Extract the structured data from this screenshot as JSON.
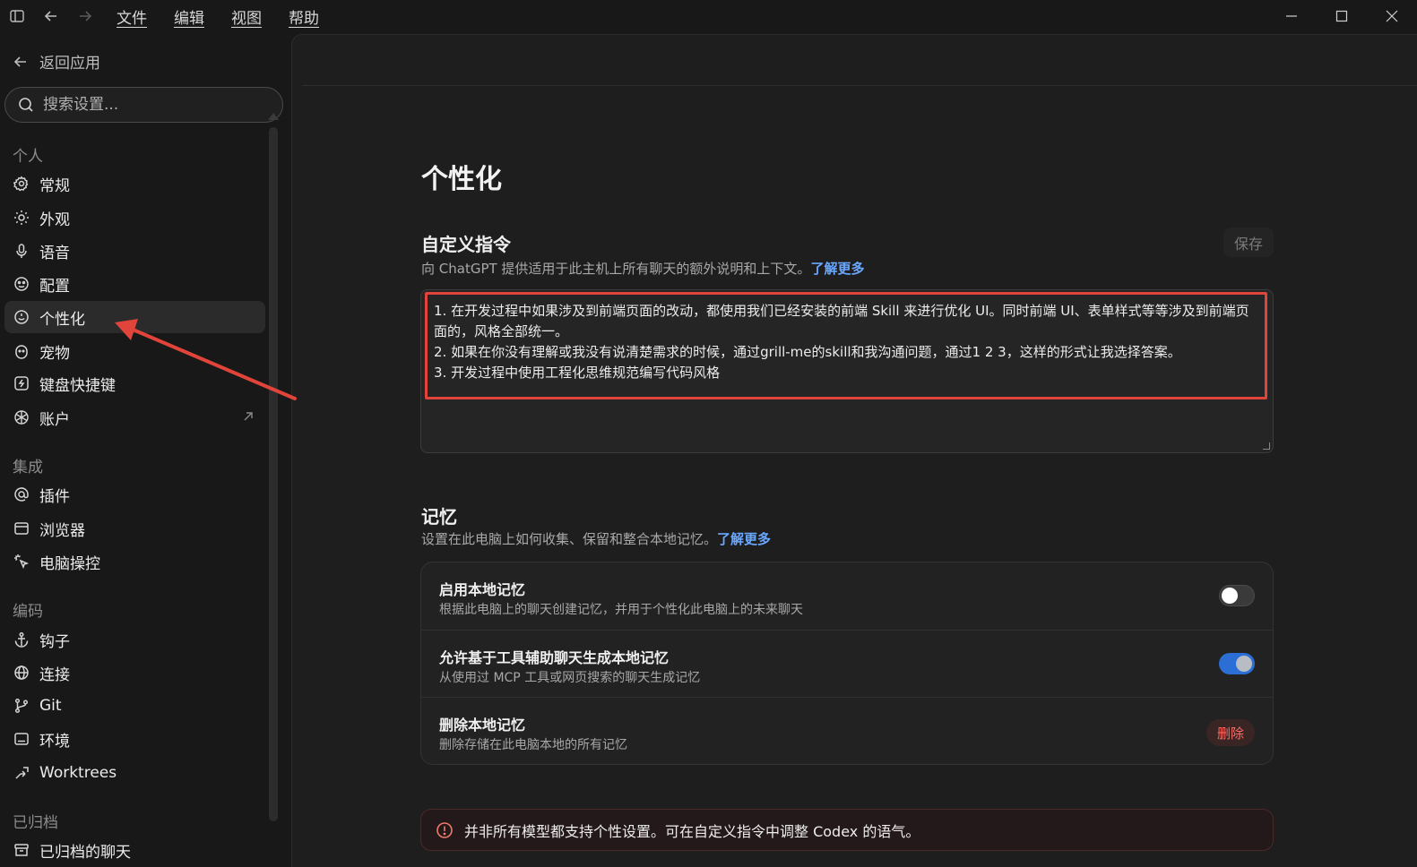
{
  "menu": [
    "文件",
    "编辑",
    "视图",
    "帮助"
  ],
  "sidebar": {
    "back_label": "返回应用",
    "search_placeholder": "搜索设置...",
    "groups": {
      "personal": "个人",
      "integrations": "集成",
      "coding": "编码",
      "archived": "已归档"
    },
    "items": {
      "general": "常规",
      "appearance": "外观",
      "voice": "语音",
      "config": "配置",
      "personalization": "个性化",
      "pets": "宠物",
      "shortcuts": "键盘快捷键",
      "account": "账户",
      "plugins": "插件",
      "browser": "浏览器",
      "computer_use": "电脑操控",
      "hooks": "钩子",
      "connections": "连接",
      "git": "Git",
      "environments": "环境",
      "worktrees": "Worktrees",
      "archived_chats": "已归档的聊天"
    }
  },
  "main": {
    "title": "个性化",
    "custom": {
      "title": "自定义指令",
      "desc": "向 ChatGPT 提供适用于此主机上所有聊天的额外说明和上下文。",
      "link": "了解更多",
      "save": "保存",
      "lines": [
        "1. 在开发过程中如果涉及到前端页面的改动，都使用我们已经安装的前端 Skill 来进行优化 UI。同时前端 UI、表单样式等等涉及到前端页面的，风格全部统一。",
        "2. 如果在你没有理解或我没有说清楚需求的时候，通过grill-me的skill和我沟通问题，通过1 2 3，这样的形式让我选择答案。",
        "3. 开发过程中使用工程化思维规范编写代码风格"
      ]
    },
    "memory": {
      "title": "记忆",
      "desc": "设置在此电脑上如何收集、保留和整合本地记忆。",
      "link": "了解更多",
      "rows": [
        {
          "title": "启用本地记忆",
          "desc": "根据此电脑上的聊天创建记忆，并用于个性化此电脑上的未来聊天",
          "state": false
        },
        {
          "title": "允许基于工具辅助聊天生成本地记忆",
          "desc": "从使用过 MCP 工具或网页搜索的聊天生成记忆",
          "state": true
        },
        {
          "title": "删除本地记忆",
          "desc": "删除存储在此电脑本地的所有记忆",
          "action": "删除"
        }
      ]
    },
    "notice": "并非所有模型都支持个性设置。可在自定义指令中调整 Codex 的语气。"
  },
  "colors": {
    "accent": "#2b6fd6",
    "link": "#6aa8ff",
    "danger": "#ff6b63",
    "annotation": "#e0443a"
  }
}
